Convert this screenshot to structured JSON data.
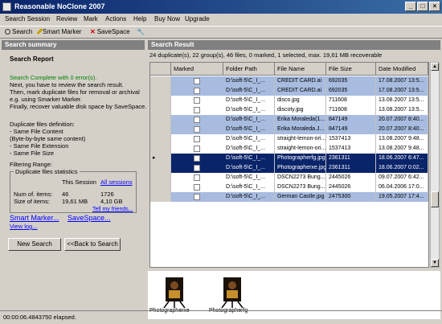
{
  "window": {
    "title": "Reasonable NoClone 2007"
  },
  "menu": [
    "Search Session",
    "Review",
    "Mark",
    "Actions",
    "Help",
    "Buy Now",
    "Upgrade"
  ],
  "toolbar": {
    "search": "Search",
    "smart_marker": "Smart Marker",
    "savespace": "SaveSpace"
  },
  "left": {
    "header": "Search summary",
    "title": "Search Report",
    "complete": "Search Complete with 0 error(s).",
    "instr": [
      "Next, you have to review the search result.",
      "Then, mark duplicate files for removal or archival",
      "e.g. using Smarker Marker.",
      "Finally, recover valuable disk space by SaveSpace."
    ],
    "defs": [
      "Duplicate files definition:",
      " - Same File Content",
      "(Byte-by-byte same content)",
      " - Same File Extension",
      " - Same File Size"
    ],
    "filtering": "Filtering Range:",
    "stats": {
      "title": "Duplicate files statistics",
      "this_session": "This Session",
      "all_sessions": "All sessions",
      "num_label": "Num of. items:",
      "num_this": "46",
      "num_all": "1726",
      "size_label": "Size of items:",
      "size_this": "19,61 MB",
      "size_all": "4,10 GB"
    },
    "tell_friends": "Tell my friends...",
    "smart_marker_link": "Smart Marker...",
    "savespace_link": "SaveSpace...",
    "view_log": "View log...",
    "new_search": "New Search",
    "back_search": "<<Back to Search"
  },
  "right": {
    "header": "Search Result",
    "summary": "24 duplicate(s), 22 group(s), 46 files, 0 marked, 1 selected, max. 19,61 MB recoverable",
    "columns": [
      "Marked",
      "Folder Path",
      "File Name",
      "File Size",
      "Date Modified"
    ],
    "rows": [
      {
        "folder": "D:\\soft-5\\C_I_...",
        "name": "CREDIT CARD.ai",
        "size": "692035",
        "date": "17.08.2007 13:5...",
        "shade": "blue"
      },
      {
        "folder": "D:\\soft-5\\C_I_...",
        "name": "CREDIT CARD.ai",
        "size": "692035",
        "date": "17.08.2007 13:5...",
        "shade": "blue"
      },
      {
        "folder": "D:\\soft-5\\C_I_...",
        "name": "disco.jpg",
        "size": "711608",
        "date": "13.08.2007 13:5...",
        "shade": "white"
      },
      {
        "folder": "D:\\soft-5\\C_I_...",
        "name": "discoty.jpg",
        "size": "711608",
        "date": "13.08.2007 13:5...",
        "shade": "white"
      },
      {
        "folder": "D:\\soft-5\\C_I_...",
        "name": "Erika Moraleda(1...",
        "size": "847149",
        "date": "20.07.2007 8:40...",
        "shade": "blue"
      },
      {
        "folder": "D:\\soft-5\\C_I_...",
        "name": "Erika Moraleda.J...",
        "size": "847149",
        "date": "20.07.2007 8:40...",
        "shade": "blue"
      },
      {
        "folder": "D:\\soft-5\\C_I_...",
        "name": "straight-lemon-ori...",
        "size": "1537413",
        "date": "13.08.2007 9:48...",
        "shade": "white"
      },
      {
        "folder": "D:\\soft-5\\C_I_...",
        "name": "straight-lemon-ori...",
        "size": "1537413",
        "date": "13.08.2007 9:48...",
        "shade": "white"
      },
      {
        "folder": "D:\\soft-5\\C_I_...",
        "name": "Photographerfg.jpg",
        "size": "2361311",
        "date": "18.06.2007 6:47...",
        "shade": "selected"
      },
      {
        "folder": "D:\\soft-5\\C_I_...",
        "name": "Photographerxe.jpg",
        "size": "2361311",
        "date": "18.06.2007 0:02...",
        "shade": "selected"
      },
      {
        "folder": "D:\\soft-5\\C_I_...",
        "name": "DSCN2273 Bung...",
        "size": "2445026",
        "date": "09.07.2007 6:42...",
        "shade": "white"
      },
      {
        "folder": "D:\\soft-5\\C_I_...",
        "name": "DSCN2273 Bung...",
        "size": "2445026",
        "date": "06.04.2006 17:0...",
        "shade": "white"
      },
      {
        "folder": "D:\\soft-5\\C_I_...",
        "name": "German Castle.jpg",
        "size": "2475300",
        "date": "19.05.2007 17:4...",
        "shade": "blue"
      }
    ],
    "thumbs": [
      "Photographerxe",
      "Photographerfg"
    ]
  },
  "status": "00:00:06.4843750 elapsed."
}
